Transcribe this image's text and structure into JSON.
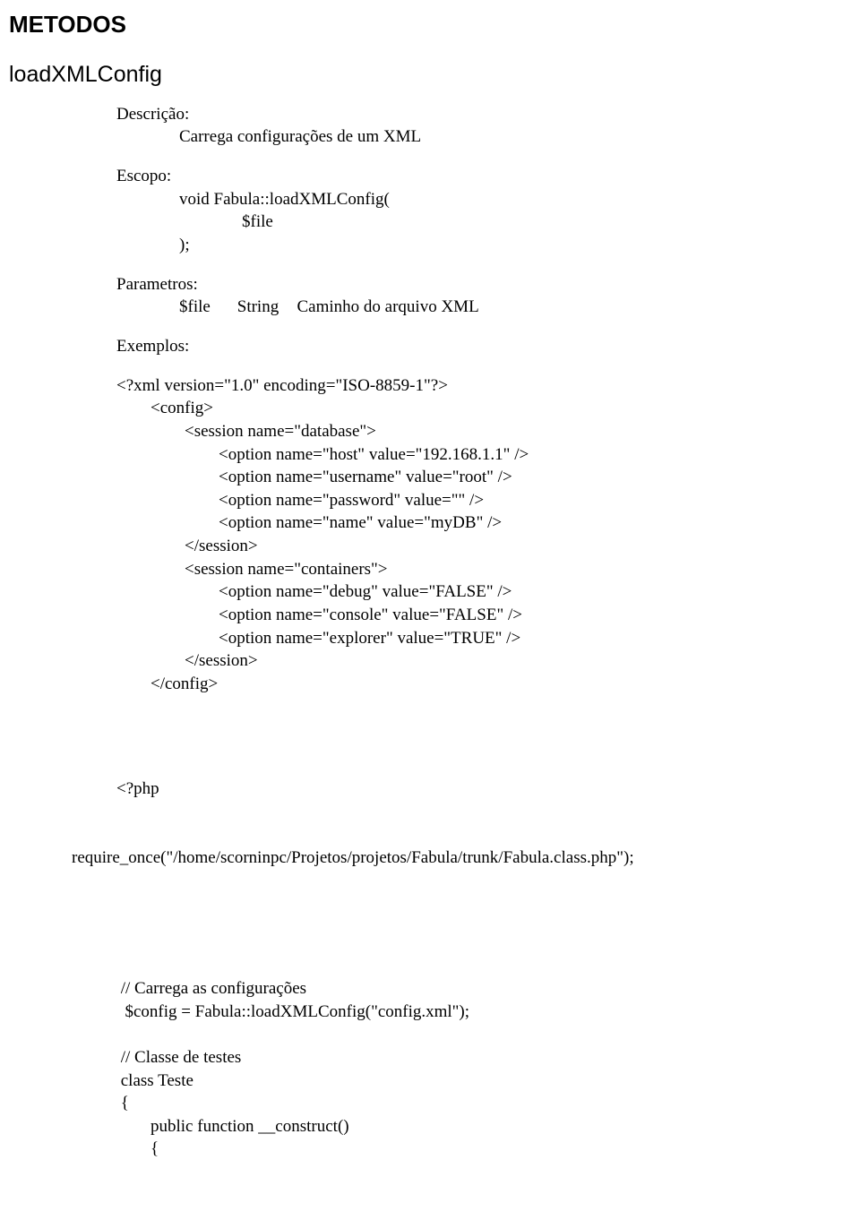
{
  "heading": "METODOS",
  "method_name": "loadXMLConfig",
  "descricao": {
    "label": "Descrição:",
    "text": "Carrega configurações de um XML"
  },
  "escopo": {
    "label": "Escopo:",
    "line1": "void Fabula::loadXMLConfig(",
    "line2": "$file",
    "line3": ");"
  },
  "parametros": {
    "label": "Parametros:",
    "name": "$file",
    "type": "String",
    "desc": "Caminho do arquivo XML"
  },
  "exemplos": {
    "label": "Exemplos:"
  },
  "xml_example": "<?xml version=\"1.0\" encoding=\"ISO-8859-1\"?>\n        <config>\n                <session name=\"database\">\n                        <option name=\"host\" value=\"192.168.1.1\" />\n                        <option name=\"username\" value=\"root\" />\n                        <option name=\"password\" value=\"\" />\n                        <option name=\"name\" value=\"myDB\" />\n                </session>\n                <session name=\"containers\">\n                        <option name=\"debug\" value=\"FALSE\" />\n                        <option name=\"console\" value=\"FALSE\" />\n                        <option name=\"explorer\" value=\"TRUE\" />\n                </session>\n        </config>",
  "php_line1": "<?php",
  "php_line2": "require_once(\"/home/scorninpc/Projetos/projetos/Fabula/trunk/Fabula.class.php\");",
  "php_block2": " // Carrega as configurações\n  $config = Fabula::loadXMLConfig(\"config.xml\");\n\n // Classe de testes\n class Teste\n {\n        public function __construct()\n        {"
}
